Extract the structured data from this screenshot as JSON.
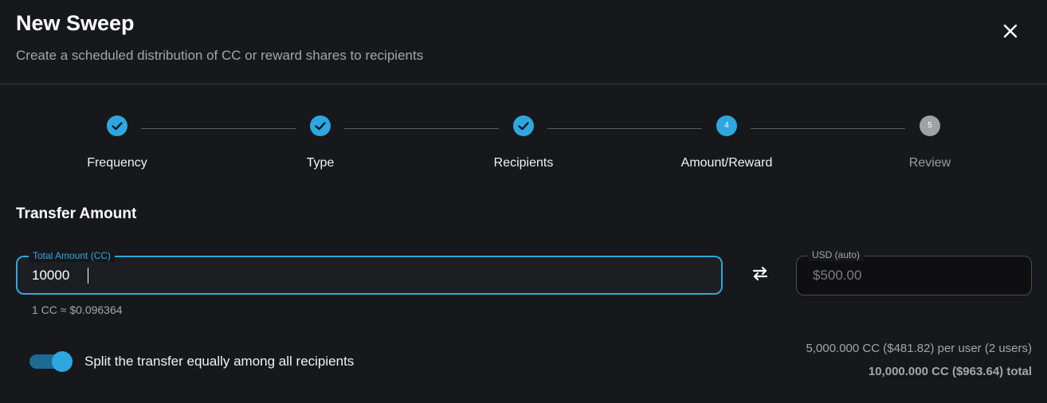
{
  "dialog": {
    "title": "New Sweep",
    "subtitle": "Create a scheduled distribution of CC or reward shares to recipients",
    "close_icon": "close-icon"
  },
  "colors": {
    "accent": "#2ea7e0",
    "background": "#17181c",
    "pending": "#a0a1a6"
  },
  "stepper": {
    "current_step": 4,
    "steps": [
      {
        "number": "1",
        "label": "Frequency",
        "status": "done"
      },
      {
        "number": "2",
        "label": "Type",
        "status": "done"
      },
      {
        "number": "3",
        "label": "Recipients",
        "status": "done"
      },
      {
        "number": "4",
        "label": "Amount/Reward",
        "status": "active"
      },
      {
        "number": "5",
        "label": "Review",
        "status": "pending"
      }
    ]
  },
  "transfer": {
    "section_title": "Transfer Amount",
    "amount_label": "Total Amount (CC)",
    "amount_value": "10000",
    "rate": "1 CC ≈ $0.096364",
    "swap_icon": "swap-arrows-icon",
    "usd_label": "USD (auto)",
    "usd_placeholder": "$500.00"
  },
  "split": {
    "enabled": true,
    "label": "Split the transfer equally among all recipients",
    "per_user": "5,000.000 CC ($481.82) per user (2 users)",
    "total": "10,000.000 CC ($963.64) total"
  }
}
